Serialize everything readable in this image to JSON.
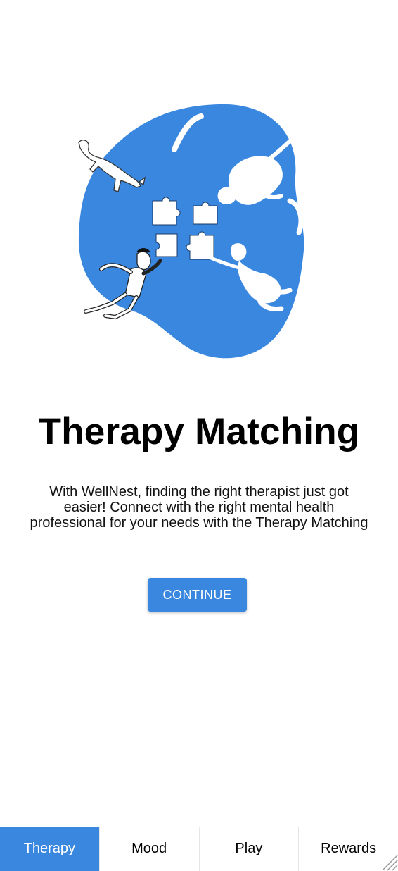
{
  "onboarding": {
    "title": "Therapy Matching",
    "description": "With WellNest, finding the right therapist just got easier! Connect with the right mental health professional for your needs with the Therapy Matching",
    "continue_label": "CONTINUE",
    "illustration": "therapy-matching-illustration"
  },
  "bottom_nav": {
    "tabs": [
      {
        "label": "Therapy",
        "active": true
      },
      {
        "label": "Mood",
        "active": false
      },
      {
        "label": "Play",
        "active": false
      },
      {
        "label": "Rewards",
        "active": false
      }
    ]
  },
  "colors": {
    "accent": "#3a87df",
    "text": "#000000",
    "background": "#ffffff"
  }
}
